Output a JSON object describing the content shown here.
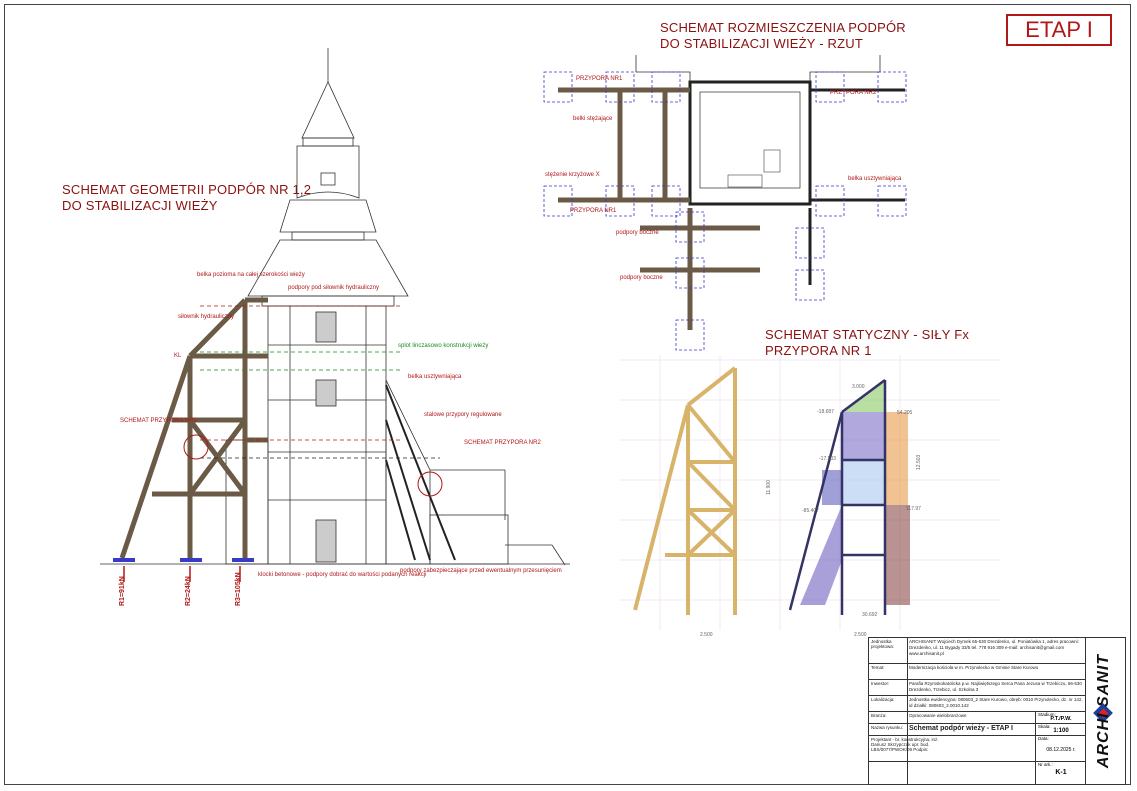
{
  "etap": "ETAP I",
  "titles": {
    "geometry": [
      "SCHEMAT GEOMETRII PODPÓR NR 1,2",
      "DO STABILIZACJI WIEŻY"
    ],
    "layout": [
      "SCHEMAT ROZMIESZCZENIA PODPÓR",
      "DO STABILIZACJI WIEŻY - RZUT"
    ],
    "static": [
      "SCHEMAT STATYCZNY - SIŁY Fx",
      "PRZYPORA NR 1"
    ]
  },
  "labels": {
    "belka_cala": "belka pozioma na całej szerokości wieży",
    "podpory_silownik": "podpory pod siłownik hydrauliczny",
    "silownik": "siłownik hydrauliczny",
    "splot": "splot linczasowo konstrukcji wieży",
    "belka_usztyw": "belka usztywniająca",
    "schemat_p1": "SCHEMAT PRZYPORA NR1",
    "schemat_p2": "SCHEMAT PRZYPORA NR2",
    "stalowe": "stalowe przypory regulowane",
    "klocki": "klocki betonowe - podpory dobrać do wartości podanych reakcji",
    "podpory_zab": "podpory zabezpieczające przed ewentualnym przesunięciem",
    "kl": "KL",
    "r1": "R1=91kN",
    "r2": "R2=24kN",
    "r3": "R3=105kN",
    "przypora1": "PRZYPORA NR1",
    "przypora2": "PRZYPORA NR2",
    "belki_stezajace": "belki stężające",
    "krzyzowe": "stężenie krzyżowe X",
    "podpory_boczne": "podpory boczne",
    "belka_usztyw_rzut": "belka usztywniająca"
  },
  "dims": {
    "w1": "2.500",
    "w2": "2.500",
    "h1": "11.900",
    "h2": "12.503",
    "f1": "-18.687",
    "f2": "-85.407",
    "f3": "54.205",
    "f4": "117.97",
    "f5": "-17.503",
    "f6": "3.000",
    "f7": "30.692"
  },
  "titleblock": {
    "rows": [
      {
        "k": "Jednostka projektowa:",
        "v": "ARCHISANIT Wojciech Dymek 65-530 Drezdenko, ul. Poniatówka 1, adres pracowni: Drezdenko, ul. 11 Bygady 33/5 tel. 778 916 309 e-mail: archisanit@gmail.com www.archisanit.pl"
      },
      {
        "k": "Temat:",
        "v": "Modernizacja kościoła w m. Przynolecko w Gminie Stare Kurowo"
      },
      {
        "k": "Inwestor:",
        "v": "Parafia Rzymskokatolicka p.w. Najświętszego Serca Pana Jezusa w Trzebiczu, 66-530 Drezdenko, Trzebicz, ul. Szkolna 3"
      },
      {
        "k": "Lokalizacja:",
        "v": "Jednostka ewidencyjna: 080603_2 Stare Kurowo, obręb: 0010 Przynolecko, dz. nr 142, id działki: 080603_2.0010.142"
      },
      {
        "k": "Branża:",
        "v": "Opracowanie wielobranżowe"
      },
      {
        "k": "Nazwa rysunku:",
        "v": "Schemat podpór wieży - ETAP I"
      },
      {
        "k": "Projektant:",
        "v": "Projektant - br. konstrukcyjna, inż. Dariusz Skrzypczak upr. bud. LBS/0077/PWOK/09 Podpis:"
      },
      {
        "k": "",
        "v": ""
      }
    ],
    "stadium_k": "Stadium:",
    "stadium_v": "P.T./P.W.",
    "skala_k": "Skala:",
    "skala_v": "1:100",
    "data_k": "Data:",
    "data_v": "08.12.2025 r.",
    "nr_k": "Nr ark.:",
    "nr_v": "K-1",
    "logo": "ARCHI SANIT"
  }
}
